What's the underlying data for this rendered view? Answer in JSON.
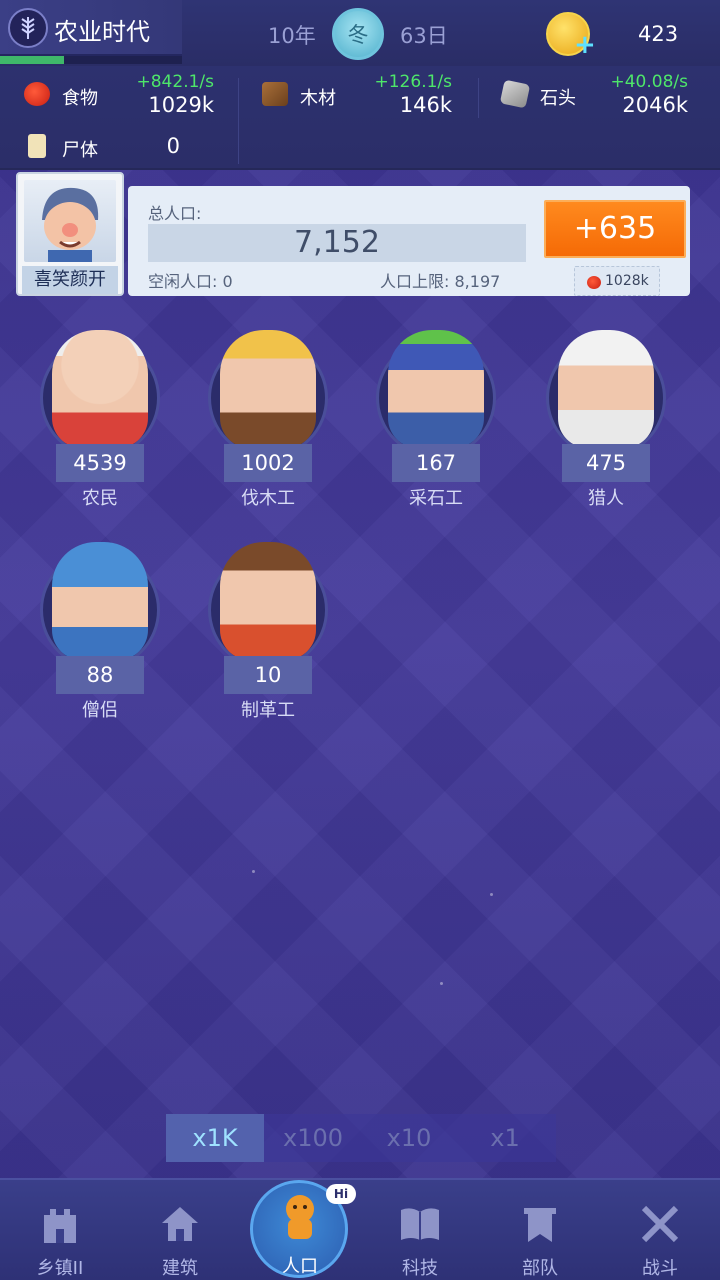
{
  "era": {
    "title": "农业时代",
    "icon": "wheat-icon",
    "progress": 0.35
  },
  "date": {
    "year": "10年",
    "season": "冬",
    "day": "63日"
  },
  "currency": {
    "icon": "gold-coin-icon",
    "value": "423"
  },
  "resources": [
    {
      "name": "食物",
      "icon": "apple-icon",
      "rate": "+842.1/s",
      "amount": "1029k"
    },
    {
      "name": "木材",
      "icon": "wood-icon",
      "rate": "+126.1/s",
      "amount": "146k"
    },
    {
      "name": "石头",
      "icon": "stone-icon",
      "rate": "+40.08/s",
      "amount": "2046k"
    },
    {
      "name": "尸体",
      "icon": "corpse-icon",
      "amount": "0"
    }
  ],
  "population": {
    "leader_label": "喜笑颜开",
    "total_label": "总人口:",
    "total": "7,152",
    "idle_label": "空闲人口:",
    "idle": "0",
    "cap_label": "人口上限:",
    "cap": "8,197",
    "add_button": "+635",
    "cost": "1028k"
  },
  "jobs": [
    {
      "name": "农民",
      "count": "4539"
    },
    {
      "name": "伐木工",
      "count": "1002"
    },
    {
      "name": "采石工",
      "count": "167"
    },
    {
      "name": "猎人",
      "count": "475"
    },
    {
      "name": "僧侣",
      "count": "88"
    },
    {
      "name": "制革工",
      "count": "10"
    }
  ],
  "multipliers": [
    "x1K",
    "x100",
    "x10",
    "x1"
  ],
  "active_multiplier": "x1K",
  "nav": [
    {
      "label": "乡镇II",
      "icon": "castle-icon"
    },
    {
      "label": "建筑",
      "icon": "house-icon"
    },
    {
      "label": "人口",
      "icon": "person-icon",
      "badge": "Hi"
    },
    {
      "label": "科技",
      "icon": "book-icon"
    },
    {
      "label": "部队",
      "icon": "banner-icon"
    },
    {
      "label": "战斗",
      "icon": "crossed-swords-icon"
    }
  ]
}
